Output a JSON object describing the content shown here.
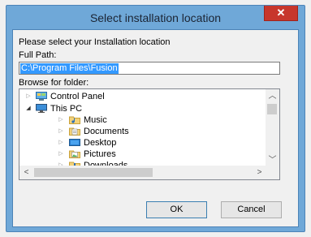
{
  "dialog": {
    "title": "Select installation location",
    "close_glyph": "✕",
    "instruction": "Please select your Installation location",
    "full_path_label": "Full Path:",
    "full_path_value": "C:\\Program Files\\Fusion",
    "browse_label": "Browse for folder:",
    "tree": [
      {
        "label": "Control Panel",
        "icon": "control-panel-icon",
        "expanded": false,
        "level": 0
      },
      {
        "label": "This PC",
        "icon": "computer-icon",
        "expanded": true,
        "level": 0
      },
      {
        "label": "Music",
        "icon": "music-folder-icon",
        "expanded": false,
        "level": 1
      },
      {
        "label": "Documents",
        "icon": "documents-folder-icon",
        "expanded": false,
        "level": 1
      },
      {
        "label": "Desktop",
        "icon": "desktop-folder-icon",
        "expanded": false,
        "level": 1
      },
      {
        "label": "Pictures",
        "icon": "pictures-folder-icon",
        "expanded": false,
        "level": 1
      },
      {
        "label": "Downloads",
        "icon": "downloads-folder-icon",
        "expanded": false,
        "level": 1
      }
    ],
    "ok_label": "OK",
    "cancel_label": "Cancel"
  }
}
